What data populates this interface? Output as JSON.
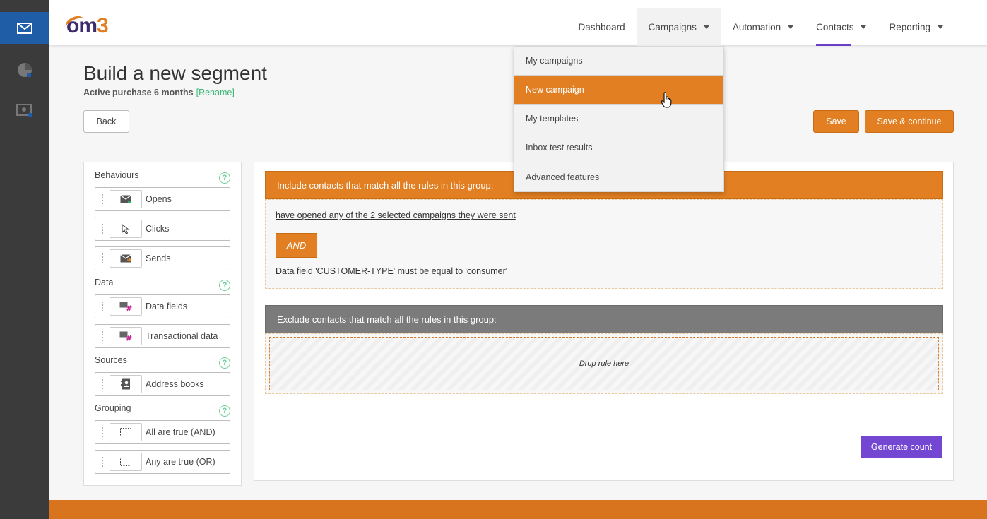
{
  "logo": {
    "o": "o",
    "m": "m",
    "three": "3"
  },
  "nav": {
    "items": [
      {
        "label": "Dashboard"
      },
      {
        "label": "Campaigns"
      },
      {
        "label": "Automation"
      },
      {
        "label": "Contacts"
      },
      {
        "label": "Reporting"
      }
    ]
  },
  "campaigns_menu": {
    "items": [
      {
        "label": "My campaigns"
      },
      {
        "label": "New campaign"
      },
      {
        "label": "My templates"
      },
      {
        "label": "Inbox test results"
      },
      {
        "label": "Advanced features"
      }
    ]
  },
  "page": {
    "title": "Build a new segment",
    "segment_name": "Active purchase 6 months",
    "rename_label": "[Rename]",
    "back_label": "Back",
    "save_label": "Save",
    "save_continue_label": "Save & continue"
  },
  "palette": {
    "sections": [
      {
        "heading": "Behaviours",
        "tiles": [
          {
            "label": "Opens",
            "icon": "envelope-open-icon"
          },
          {
            "label": "Clicks",
            "icon": "cursor-arrow-icon"
          },
          {
            "label": "Sends",
            "icon": "envelope-send-icon"
          }
        ]
      },
      {
        "heading": "Data",
        "tiles": [
          {
            "label": "Data fields",
            "icon": "data-field-hash-icon"
          },
          {
            "label": "Transactional data",
            "icon": "transactional-hash-icon"
          }
        ]
      },
      {
        "heading": "Sources",
        "tiles": [
          {
            "label": "Address books",
            "icon": "address-book-icon"
          }
        ]
      },
      {
        "heading": "Grouping",
        "tiles": [
          {
            "label": "All are true (AND)",
            "icon": "group-box-icon"
          },
          {
            "label": "Any are true (OR)",
            "icon": "group-box-icon"
          }
        ]
      }
    ],
    "help_symbol": "?"
  },
  "builder": {
    "include_header": "Include contacts that match all the rules in this group:",
    "include_rules": [
      "have opened any of the 2 selected campaigns they were sent",
      "Data field 'CUSTOMER-TYPE' must be equal to 'consumer'"
    ],
    "and_label": "AND",
    "exclude_header": "Exclude contacts that match all the rules in this group:",
    "drop_label": "Drop rule here",
    "generate_label": "Generate count"
  },
  "colors": {
    "accent_orange": "#e17f22",
    "accent_purple": "#7447d3",
    "rail_bg": "#3b3b3b",
    "rail_active": "#1f5ea6",
    "help_green": "#6fcf97"
  }
}
